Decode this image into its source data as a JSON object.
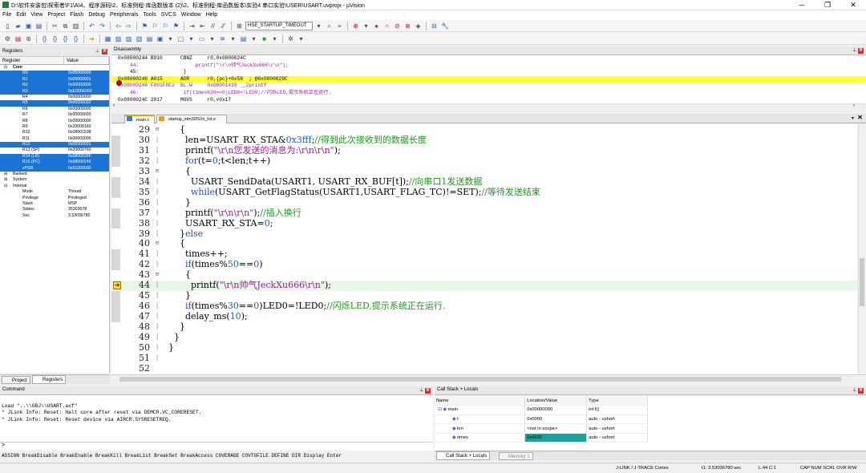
{
  "window": {
    "title": "D:\\软件安装包\\探索者\\F1\\A\\4、程序源码\\2、标准例程-库函数版本 (2)\\2、标准例程-库函数版本\\实验4 串口实验\\USER\\USART.uvprojx - µVision",
    "minimize": "─",
    "maximize": "❐",
    "close": "✕"
  },
  "menu": [
    "File",
    "Edit",
    "View",
    "Project",
    "Flash",
    "Debug",
    "Peripherals",
    "Tools",
    "SVCS",
    "Window",
    "Help"
  ],
  "toolbar": {
    "target_dropdown": "HSE_STARTUP_TIMEOUT"
  },
  "registers": {
    "panel_title": "Registers",
    "col_register": "Register",
    "col_value": "Value",
    "core_label": "Core",
    "core": [
      {
        "name": "R0",
        "value": "0x00000000",
        "sel": true
      },
      {
        "name": "R1",
        "value": "0x00000001",
        "sel": true
      },
      {
        "name": "R2",
        "value": "0x00000000",
        "sel": true
      },
      {
        "name": "R3",
        "value": "0xE000E000",
        "sel": true
      },
      {
        "name": "R4",
        "value": "0x00000000",
        "sel": false
      },
      {
        "name": "R5",
        "value": "0x00000032",
        "sel": true
      },
      {
        "name": "R6",
        "value": "0x00000000",
        "sel": false
      },
      {
        "name": "R7",
        "value": "0x00000000",
        "sel": false
      },
      {
        "name": "R8",
        "value": "0x00000000",
        "sel": false
      },
      {
        "name": "R9",
        "value": "0x20000160",
        "sel": false
      },
      {
        "name": "R10",
        "value": "0x08001538",
        "sel": false
      },
      {
        "name": "R11",
        "value": "0x00000000",
        "sel": false
      },
      {
        "name": "R12",
        "value": "0x00000001",
        "sel": true
      },
      {
        "name": "R13 (SP)",
        "value": "0x20000760",
        "sel": false
      },
      {
        "name": "R14 (LR)",
        "value": "0x0800026F",
        "sel": true
      },
      {
        "name": "R15 (PC)",
        "value": "0x08000246",
        "sel": true
      },
      {
        "name": "xPSR",
        "value": "0x01000000",
        "sel": true
      }
    ],
    "banked": "Banked",
    "system": "System",
    "internal": "Internal",
    "internal_rows": [
      {
        "name": "Mode",
        "value": "Thread"
      },
      {
        "name": "Privilege",
        "value": "Privileged"
      },
      {
        "name": "Stack",
        "value": "MSP"
      },
      {
        "name": "States",
        "value": "35303678"
      },
      {
        "name": "Sec",
        "value": "3.53036780"
      }
    ],
    "tab_project": "Project",
    "tab_registers": "Registers"
  },
  "disassembly": {
    "title": "Disassembly",
    "lines": [
      {
        "text": "0x08000244 B910      CBNZ     r0,0x0800024C",
        "hl": false
      },
      {
        "text": "    44:                   printf(\"\\r\\n帅气JeckXu666\\r\\n\");",
        "hl": false
      },
      {
        "text": "    45:               }",
        "hl": false
      },
      {
        "text": "0x08000246 A015      ADR      r0,{pc}+0x58  ; @0x0800029C",
        "hl": true
      },
      {
        "text": "0x08000248 F001F8E2  BL.W     0x08001410 __2printf",
        "hl": false
      },
      {
        "text": "    46:               if(times%30==0)LED0=!LED0;//闪烁LED,提示系统正在运行.",
        "hl": false
      },
      {
        "text": "0x0800024C 2017      MOVS     r0,#0x17",
        "hl": false
      }
    ]
  },
  "editor": {
    "tab1": "main.c",
    "tab2": "startup_stm32f10x_hd.s",
    "lines": [
      {
        "n": "29",
        "fold": "⊟",
        "text": "        {"
      },
      {
        "n": "30",
        "fold": "",
        "text": "          len=USART_RX_STA&0x3fff;//得到此次接收到的数据长度"
      },
      {
        "n": "31",
        "fold": "",
        "text": "          printf(\"\\r\\n您发送的消息为:\\r\\n\\r\\n\");"
      },
      {
        "n": "32",
        "fold": "",
        "text": "          for(t=0;t<len;t++)"
      },
      {
        "n": "33",
        "fold": "⊟",
        "text": "          {"
      },
      {
        "n": "34",
        "fold": "",
        "text": "            USART_SendData(USART1, USART_RX_BUF[t]);//向串口1发送数据"
      },
      {
        "n": "35",
        "fold": "",
        "text": "            while(USART_GetFlagStatus(USART1,USART_FLAG_TC)!=SET);//等待发送结束"
      },
      {
        "n": "36",
        "fold": "",
        "text": "          }"
      },
      {
        "n": "37",
        "fold": "",
        "text": "          printf(\"\\r\\n\\r\\n\");//插入换行"
      },
      {
        "n": "38",
        "fold": "",
        "text": "          USART_RX_STA=0;"
      },
      {
        "n": "39",
        "fold": "",
        "text": "        }else"
      },
      {
        "n": "40",
        "fold": "⊟",
        "text": "        {"
      },
      {
        "n": "41",
        "fold": "",
        "text": "          times++;"
      },
      {
        "n": "42",
        "fold": "",
        "text": "          if(times%50==0)"
      },
      {
        "n": "43",
        "fold": "⊟",
        "text": "          {"
      },
      {
        "n": "44",
        "fold": "",
        "text": "            printf(\"\\r\\n帅气JeckXu666\\r\\n\");"
      },
      {
        "n": "45",
        "fold": "",
        "text": "          }"
      },
      {
        "n": "46",
        "fold": "",
        "text": "          if(times%30==0)LED0=!LED0;//闪烁LED,提示系统正在运行."
      },
      {
        "n": "47",
        "fold": "",
        "text": "          delay_ms(10);"
      },
      {
        "n": "48",
        "fold": "",
        "text": "        }"
      },
      {
        "n": "49",
        "fold": "",
        "text": "      }"
      },
      {
        "n": "50",
        "fold": "",
        "text": "    }"
      },
      {
        "n": "51",
        "fold": "",
        "text": ""
      },
      {
        "n": "52",
        "fold": "",
        "text": ""
      }
    ]
  },
  "command": {
    "title": "Command",
    "output": "Load \"..\\\\OBJ\\\\USART.axf\"\n* JLink Info: Reset: Halt core after reset via DEMCR.VC_CORERESET.\n* JLink Info: Reset: Reset device via AIRCR.SYSRESETREQ.",
    "prompt": ">",
    "hint": "ASSIGN BreakDisable BreakEnable BreakKill BreakList BreakSet BreakAccess COVERAGE COVTOFILE DEFINE DIR Display Enter"
  },
  "callstack": {
    "title": "Call Stack + Locals",
    "col_name": "Name",
    "col_loc": "Location/Value",
    "col_type": "Type",
    "rows": [
      {
        "name": "main",
        "value": "0x00000000",
        "type": "int f()",
        "indent": 0
      },
      {
        "name": "t",
        "value": "0x0000",
        "type": "auto - ushort",
        "indent": 1
      },
      {
        "name": "len",
        "value": "<not in scope>",
        "type": "auto - ushort",
        "indent": 1
      },
      {
        "name": "times",
        "value": "0x0032",
        "type": "auto - ushort",
        "indent": 1
      }
    ],
    "tab_callstack": "Call Stack + Locals",
    "tab_memory": "Memory 1"
  },
  "status": {
    "debugger": "J-LINK / J-TRACE Cortex",
    "time": "t1: 3.53036780 sec",
    "pos": "L:44 C:1",
    "caps": "CAP NUM SCRL OVR R/W"
  }
}
